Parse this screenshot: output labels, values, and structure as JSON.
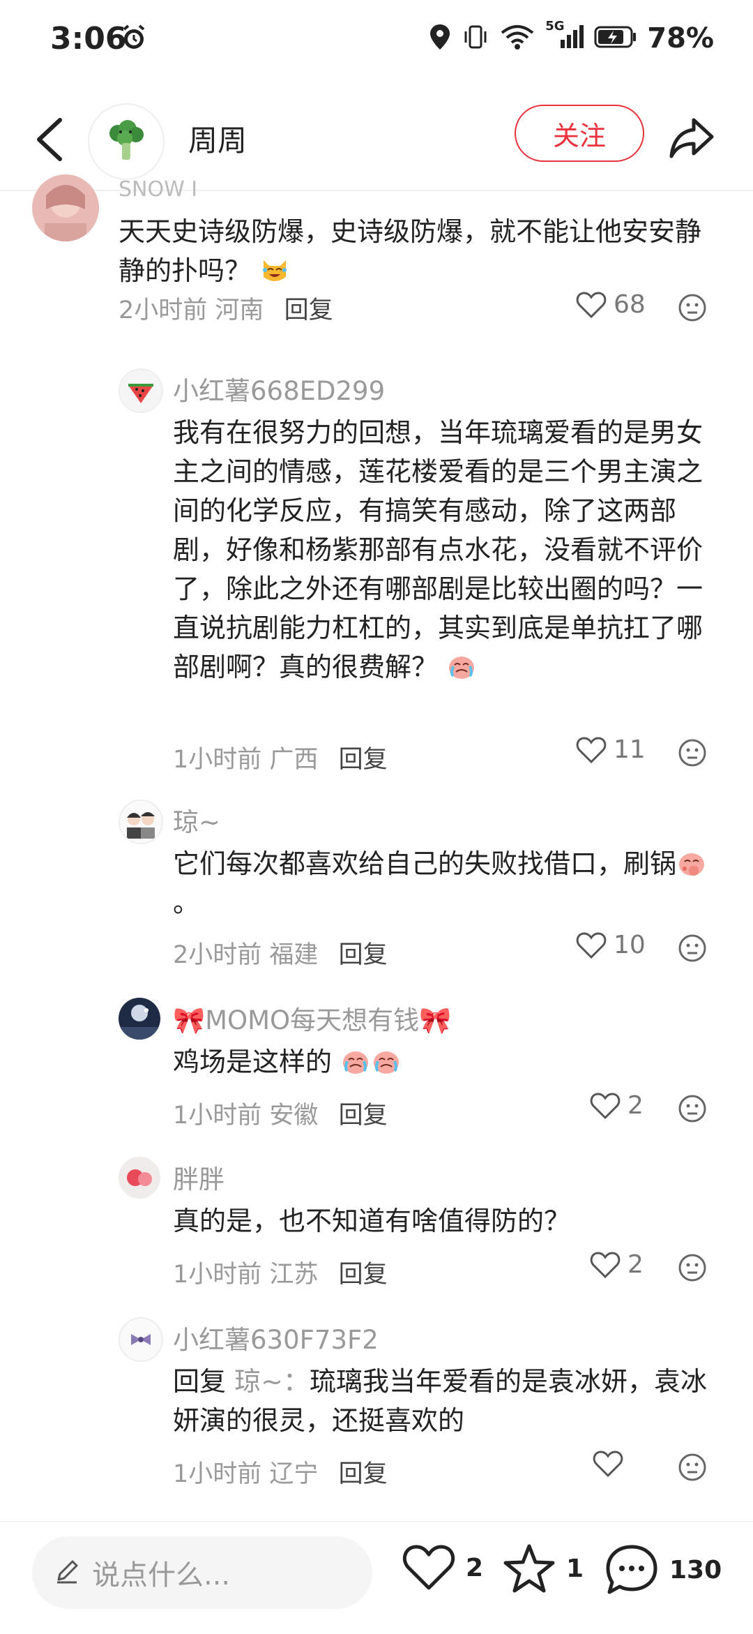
{
  "status_bar": {
    "time": "3:06",
    "network": "5G",
    "battery": "78%",
    "battery_level_percent": 78
  },
  "header": {
    "user_name": "周周",
    "follow_label": "关注"
  },
  "top_comment": {
    "username_partial": "SNOW I",
    "text": "天天史诗级防爆，史诗级防爆，就不能让他安安静静的扑吗？",
    "time": "2小时前",
    "location": "河南",
    "reply_label": "回复",
    "likes": "68"
  },
  "replies": [
    {
      "username": "小红薯668ED299",
      "text": "我有在很努力的回想，当年琉璃爱看的是男女主之间的情感，莲花楼爱看的是三个男主演之间的化学反应，有搞笑有感动，除了这两部剧，好像和杨紫那部有点水花，没看就不评价了，除此之外还有哪部剧是比较出圈的吗？一直说抗剧能力杠杠的，其实到底是单抗扛了哪部剧啊？真的很费解？",
      "time": "1小时前",
      "location": "广西",
      "reply_label": "回复",
      "likes": "11"
    },
    {
      "username": "琼~",
      "text": "它们每次都喜欢给自己的失败找借口，刷锅",
      "suffix": "。",
      "time": "2小时前",
      "location": "福建",
      "reply_label": "回复",
      "likes": "10"
    },
    {
      "username": "🎀MOMO每天想有钱🎀",
      "text": "鸡场是这样的",
      "time": "1小时前",
      "location": "安徽",
      "reply_label": "回复",
      "likes": "2"
    },
    {
      "username": "胖胖",
      "text": "真的是，也不知道有啥值得防的？",
      "time": "1小时前",
      "location": "江苏",
      "reply_label": "回复",
      "likes": "2"
    },
    {
      "username": "小红薯630F73F2",
      "reply_prefix": "回复",
      "reply_to": "琼~：",
      "text": "琉璃我当年爱看的是袁冰妍，袁冰妍演的很灵，还挺喜欢的",
      "time": "1小时前",
      "location": "辽宁",
      "reply_label": "回复",
      "likes": ""
    }
  ],
  "bottom_bar": {
    "input_placeholder": "说点什么...",
    "like_count": "2",
    "star_count": "1",
    "comment_count": "130"
  },
  "colors": {
    "accent": "#e8323c",
    "muted_text": "#999999",
    "body_text": "#222222"
  }
}
